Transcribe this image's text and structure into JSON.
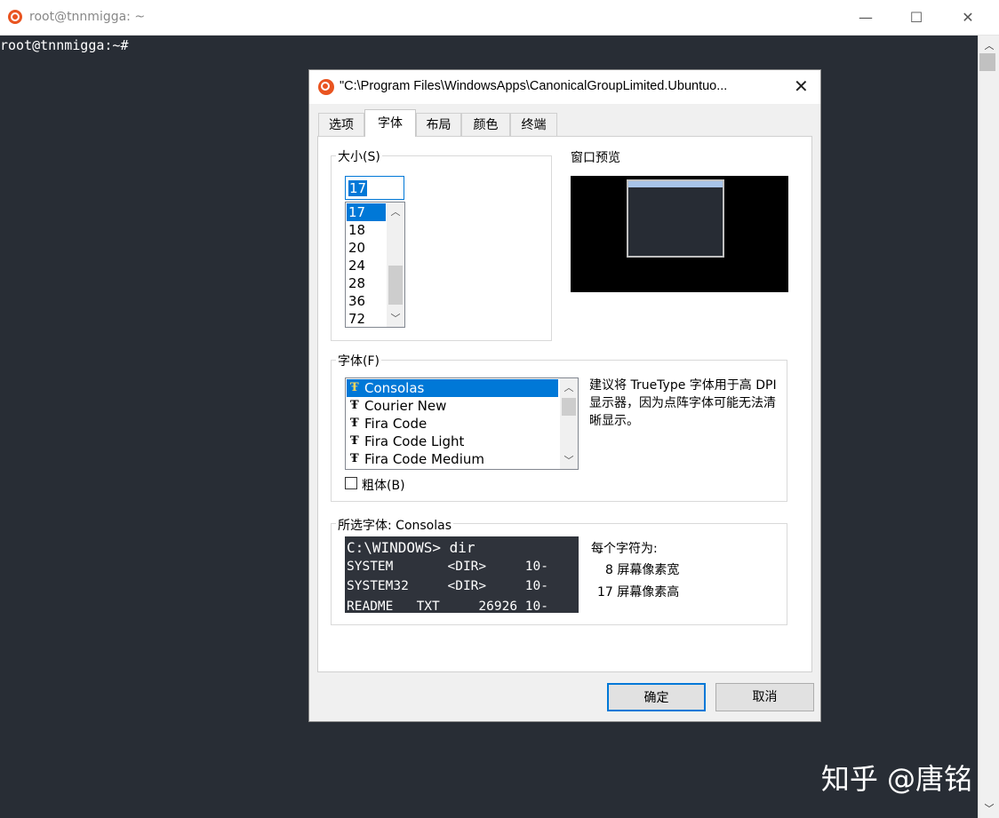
{
  "terminal": {
    "title": "root@tnnmigga: ~",
    "prompt": "root@tnnmigga:~#",
    "window_buttons": {
      "minimize": "—",
      "maximize": "☐",
      "close": "✕"
    }
  },
  "dialog": {
    "title": "\"C:\\Program Files\\WindowsApps\\CanonicalGroupLimited.Ubuntuo...",
    "close": "✕",
    "tabs": [
      {
        "label": "选项"
      },
      {
        "label": "字体",
        "active": true
      },
      {
        "label": "布局"
      },
      {
        "label": "颜色"
      },
      {
        "label": "终端"
      }
    ],
    "size_group": {
      "label": "大小(S)",
      "value": "17",
      "options": [
        "17",
        "18",
        "20",
        "24",
        "28",
        "36",
        "72"
      ],
      "selected": "17"
    },
    "preview": {
      "label": "窗口预览"
    },
    "font_group": {
      "label": "字体(F)",
      "fonts": [
        "Consolas",
        "Courier New",
        "Fira Code",
        "Fira Code Light",
        "Fira Code Medium"
      ],
      "selected": "Consolas",
      "hint": "建议将 TrueType 字体用于高 DPI 显示器，因为点阵字体可能无法清晰显示。",
      "bold_label": "粗体(B)",
      "bold_checked": false
    },
    "selected_font_group": {
      "label": "所选字体: Consolas",
      "sample_lines": [
        "C:\\WINDOWS> dir",
        "SYSTEM       <DIR>     10-",
        "SYSTEM32     <DIR>     10-",
        "README   TXT     26926 10-"
      ],
      "charinfo_title": "每个字符为:",
      "width_info": "8 屏幕像素宽",
      "height_info": "17 屏幕像素高"
    },
    "ok_label": "确定",
    "cancel_label": "取消"
  },
  "watermark": "知乎 @唐铭",
  "colors": {
    "accent": "#0078d7",
    "terminal_bg": "#282d35",
    "ubuntu_orange": "#e95420"
  }
}
